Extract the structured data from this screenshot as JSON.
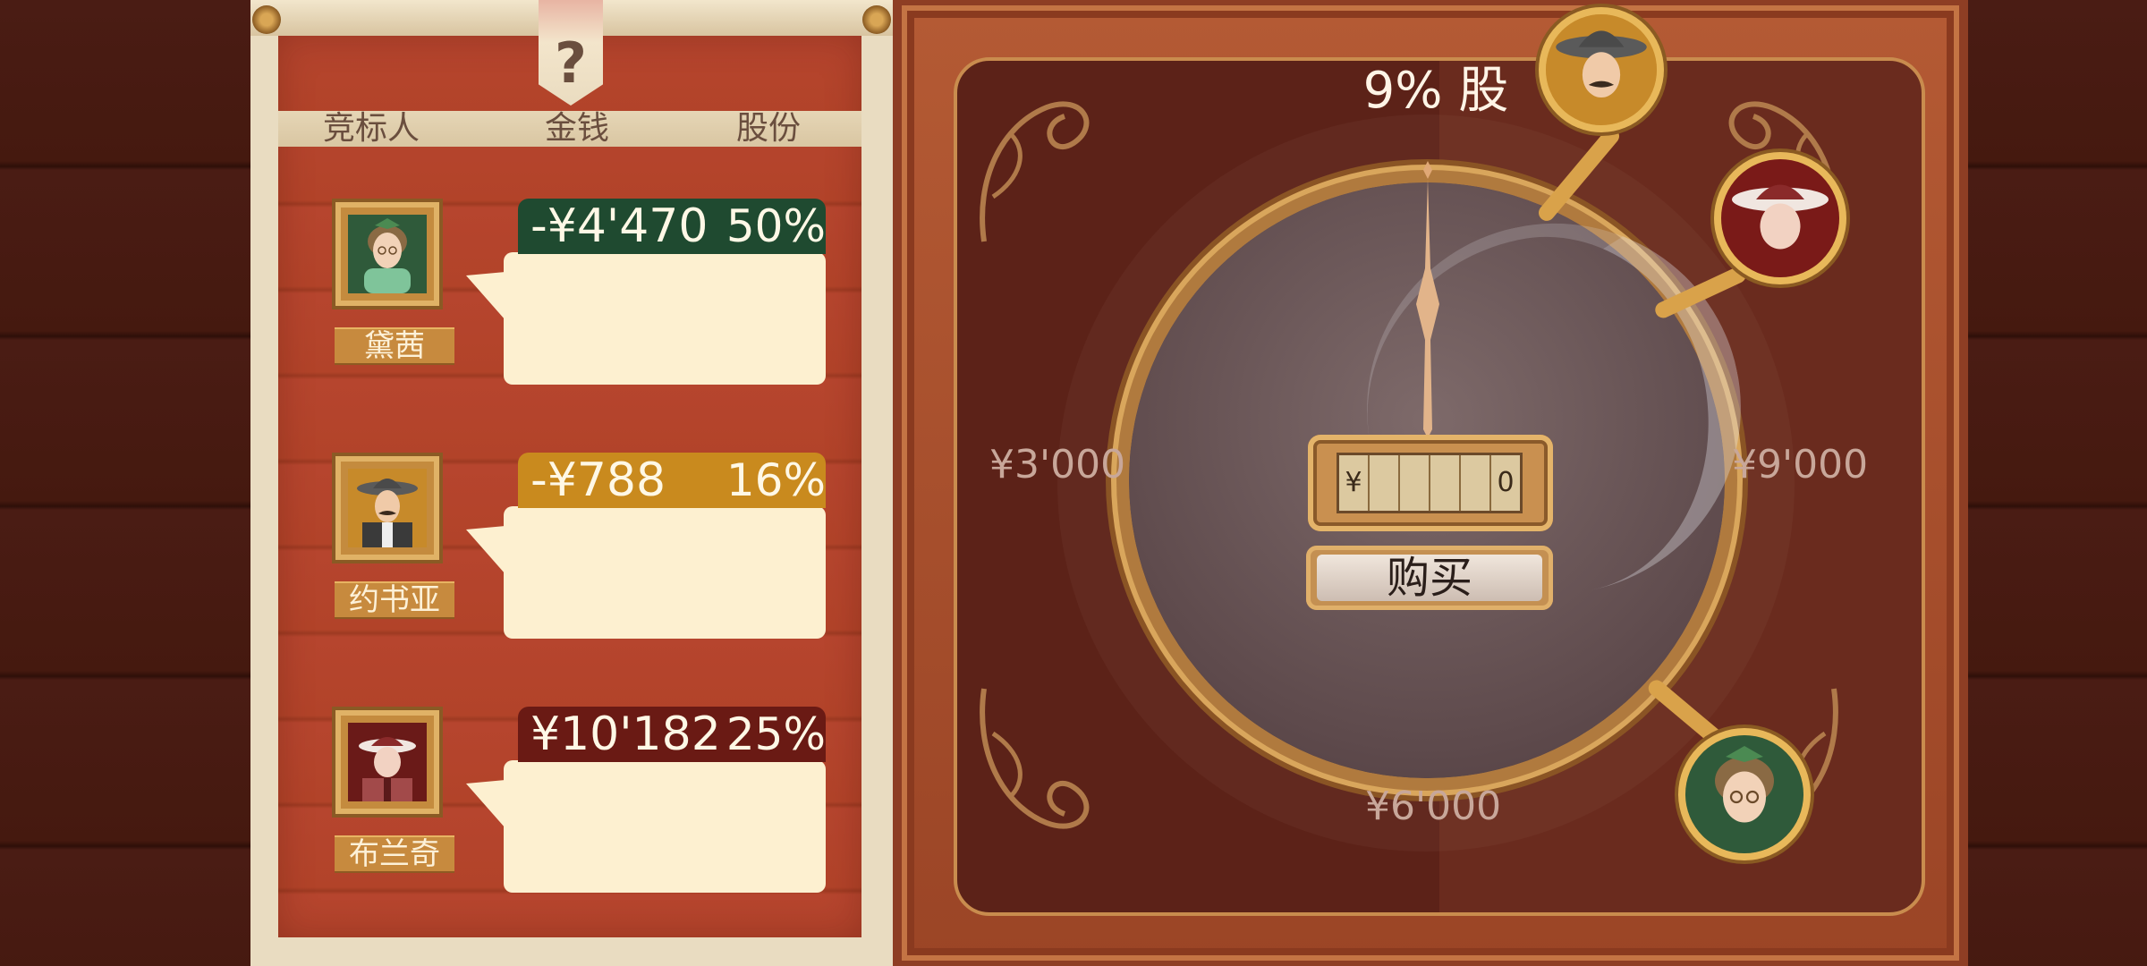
{
  "columns": {
    "bidder": "竞标人",
    "money": "金钱",
    "shares": "股份"
  },
  "help_label": "?",
  "bidders": [
    {
      "name": "黛茜",
      "amount": "-¥4'470",
      "shares": "50%",
      "bar_color": "#1f4a30"
    },
    {
      "name": "约书亚",
      "amount": "-¥788",
      "shares": "16%",
      "bar_color": "#c98a1e"
    },
    {
      "name": "布兰奇",
      "amount": "¥10'182",
      "shares": "25%",
      "bar_color": "#6a1a14"
    }
  ],
  "auction": {
    "title": "9% 股",
    "scale_left": "¥3'000",
    "scale_right": "¥9'000",
    "scale_bottom": "¥6'000",
    "price_input": {
      "currency": "¥",
      "value": "0"
    },
    "buy_label": "购买"
  },
  "icons": {
    "help": "question-mark-icon",
    "dial": "auction-dial",
    "needle": "dial-needle"
  },
  "colors": {
    "panel_red": "#b6452e",
    "bubble": "#fdf0d0",
    "gold": "#d9a24a"
  }
}
